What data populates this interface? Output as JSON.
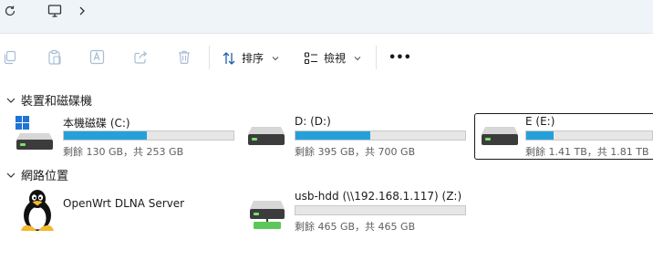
{
  "toolbar": {
    "sort_label": "排序",
    "view_label": "檢視",
    "more_label": "•••"
  },
  "sections": [
    {
      "title": "裝置和磁碟機"
    },
    {
      "title": "網路位置"
    }
  ],
  "drives": [
    {
      "name": "本機磁碟 (C:)",
      "size_text": "剩餘 130 GB，共 253 GB",
      "used_fraction": 0.49,
      "icon": "windows-drive-icon",
      "bar_color": "#26a0da"
    },
    {
      "name": "D: (D:)",
      "size_text": "剩餘 395 GB，共 700 GB",
      "used_fraction": 0.44,
      "icon": "hard-drive-icon",
      "bar_color": "#26a0da"
    },
    {
      "name": "E (E:)",
      "size_text": "剩餘 1.41 TB，共 1.81 TB",
      "used_fraction": 0.22,
      "icon": "hard-drive-icon",
      "bar_color": "#26a0da",
      "selected": true
    }
  ],
  "network": [
    {
      "name": "OpenWrt DLNA Server",
      "icon": "linux-penguin-icon"
    },
    {
      "name": "usb-hdd (\\\\192.168.1.117) (Z:)",
      "size_text": "剩餘 465 GB，共 465 GB",
      "used_fraction": 0.0,
      "icon": "network-drive-icon",
      "bar_color": "#26a0da"
    }
  ]
}
